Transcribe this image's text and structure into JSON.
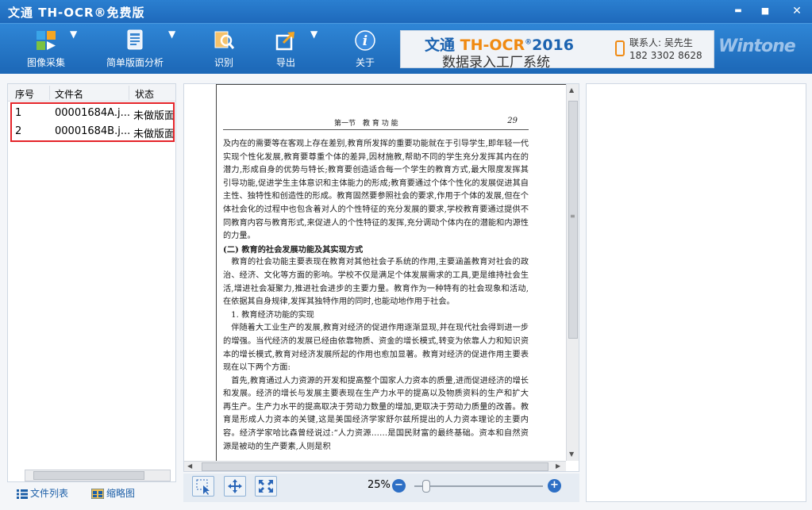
{
  "window": {
    "title": "文通 TH-OCR®免费版",
    "minimize_label": "▬",
    "maximize_label": "■",
    "close_label": "✕"
  },
  "toolbar": {
    "items": [
      {
        "label": "图像采集",
        "icon": "image-capture-icon",
        "has_dropdown": true
      },
      {
        "label": "简单版面分析",
        "icon": "layout-analysis-icon",
        "has_dropdown": true
      },
      {
        "label": "识别",
        "icon": "recognize-icon",
        "has_dropdown": false
      },
      {
        "label": "导出",
        "icon": "export-icon",
        "has_dropdown": true
      },
      {
        "label": "关于",
        "icon": "about-icon",
        "has_dropdown": false
      }
    ],
    "dropdown_glyph": "▼"
  },
  "banner": {
    "product_prefix": "文通",
    "product_name": " TH-OCR",
    "reg_mark": "®",
    "year": "2016",
    "tagline": "数据录入工厂系统",
    "contact_line": "联系人: 吴先生",
    "phone": "182 3302 8628",
    "brand": "Wintone"
  },
  "file_list": {
    "columns": [
      "序号",
      "文件名",
      "状态"
    ],
    "rows": [
      {
        "index": "1",
        "filename": "00001684A.j...",
        "status": "未做版面"
      },
      {
        "index": "2",
        "filename": "00001684B.j...",
        "status": "未做版面"
      }
    ]
  },
  "bottom_tabs": [
    {
      "label": "文件列表",
      "icon": "list-icon"
    },
    {
      "label": "缩略图",
      "icon": "thumbnail-icon"
    }
  ],
  "document": {
    "header_center": "第一节　教 育 功 能",
    "page_number": "29",
    "paragraphs": [
      "及内在的需要等在客观上存在差别,教育所发挥的重要功能就在于引导学生,即年轻一代实现个性化发展,教育要尊重个体的差异,因材施教,帮助不同的学生充分发挥其内在的潜力,形成自身的优势与特长;教育要创造适合每一个学生的教育方式,最大限度发挥其引导功能,促进学生主体意识和主体能力的形成;教育要通过个体个性化的发展促进其自主性、独特性和创造性的形成。教育固然要参照社会的要求,作用于个体的发展,但在个体社会化的过程中也包含着对人的个性特征的充分发展的要求,学校教育要通过提供不同教育内容与教育形式,来促进人的个性特征的发挥,充分调动个体内在的潜能和内源性的力量。",
      "(二) 教育的社会发展功能及其实现方式",
      "　教育的社会功能主要表现在教育对其他社会子系统的作用,主要涵盖教育对社会的政治、经济、文化等方面的影响。学校不仅是满足个体发展需求的工具,更是维持社会生活,增进社会凝聚力,推进社会进步的主要力量。教育作为一种特有的社会现象和活动,在依据其自身规律,发挥其独特作用的同时,也能动地作用于社会。",
      "　1. 教育经济功能的实现",
      "　伴随着大工业生产的发展,教育对经济的促进作用逐渐显现,并在现代社会得到进一步的增强。当代经济的发展已经由依靠物质、资金的增长模式,转变为依靠人力和知识资本的增长模式,教育对经济发展所起的作用也愈加显著。教育对经济的促进作用主要表现在以下两个方面:",
      "　首先,教育通过人力资源的开发和提高整个国家人力资本的质量,进而促进经济的增长和发展。经济的增长与发展主要表现在生产力水平的提高以及物质资料的生产和扩大再生产。生产力水平的提高取决于劳动力数量的增加,更取决于劳动力质量的改善。教育是形成人力资本的关键,这是美国经济学家舒尔兹所提出的人力资本理论的主要内容。经济学家哈比森曾经说过:“人力资源……是国民财富的最终基础。资本和自然资源是被动的生产要素,人则是积"
    ]
  },
  "viewer": {
    "zoom": "25%",
    "zoom_out_label": "−",
    "zoom_in_label": "+",
    "zoom_fraction": 0.06,
    "scroll_up_glyph": "▲",
    "scroll_down_glyph": "▼",
    "scroll_left_glyph": "◀",
    "scroll_right_glyph": "▶",
    "grip_glyph": "≡"
  }
}
